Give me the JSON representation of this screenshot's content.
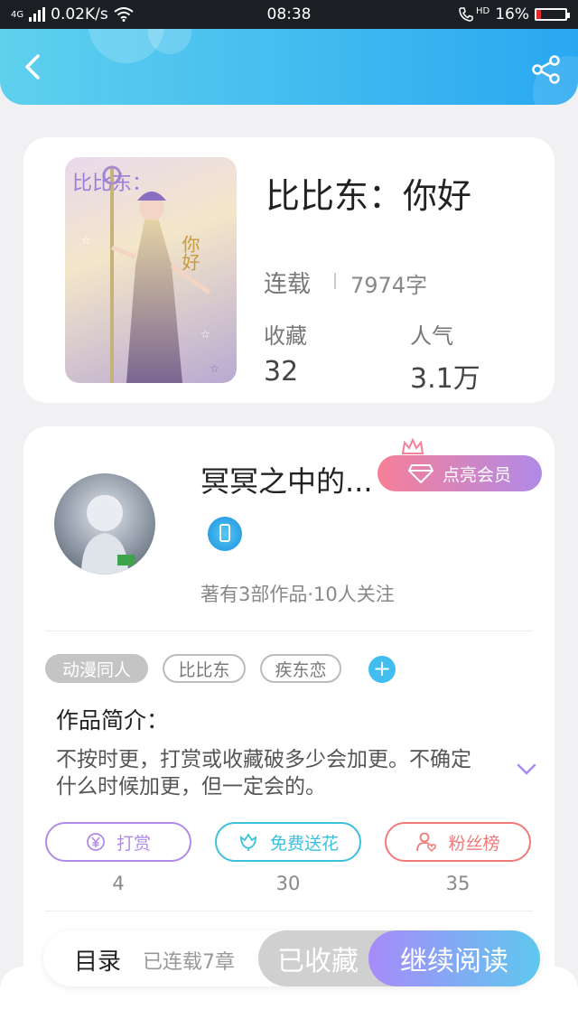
{
  "status_bar": {
    "network": "4G",
    "speed": "0.02K/s",
    "time": "08:38",
    "call": "HD",
    "battery": "16%",
    "battery_level": 0.16
  },
  "book": {
    "title": "比比东：你好",
    "status": "连载",
    "word_count": "7974字",
    "fav_label": "收藏",
    "fav_count": "32",
    "pop_label": "人气",
    "pop_count": "3.1万",
    "cover_text_top": "比比东：",
    "cover_text_right": "你好"
  },
  "author": {
    "name": "冥冥之中的...",
    "vip_label": "点亮会员",
    "meta": "著有3部作品·10人关注"
  },
  "tags": [
    "动漫同人",
    "比比东",
    "疾东恋"
  ],
  "intro": {
    "title": "作品简介：",
    "text": "不按时更，打赏或收藏破多少会加更。不确定什么时候加更，但一定会的。"
  },
  "actions": [
    {
      "label": "打赏",
      "count": "4",
      "color": "#b08ae8",
      "icon": "yen-icon"
    },
    {
      "label": "免费送花",
      "count": "30",
      "color": "#3cc1dc",
      "icon": "flower-icon"
    },
    {
      "label": "粉丝榜",
      "count": "35",
      "color": "#f07a7a",
      "icon": "fan-icon"
    }
  ],
  "bottom": {
    "toc": "目录",
    "chapters": "已连载7章",
    "fav_button": "已收藏",
    "read_button": "继续阅读"
  },
  "colors": {
    "header_start": "#5fd1ee",
    "header_end": "#29a8f1",
    "vip_gradient": [
      "#f77f97",
      "#b08ae8"
    ],
    "read_gradient": [
      "#a78bfa",
      "#5ec8ee"
    ]
  }
}
